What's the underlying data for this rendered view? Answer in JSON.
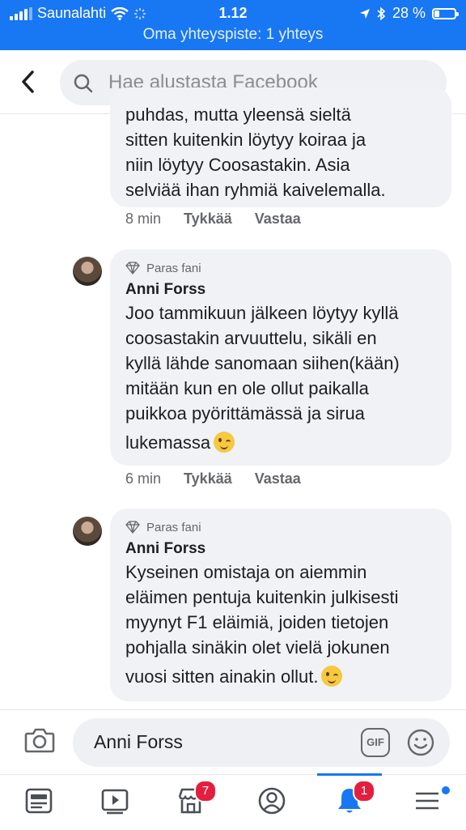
{
  "status": {
    "carrier": "Saunalahti",
    "time": "1.12",
    "battery": "28 %",
    "battery_level": 0.28
  },
  "hotspot": "Oma yhteyspiste: 1 yhteys",
  "search": {
    "placeholder": "Hae alustasta Facebook"
  },
  "comments": [
    {
      "text_lines": [
        "puhdas, mutta yleensä sieltä",
        "sitten kuitenkin löytyy koiraa ja",
        "niin löytyy Coosastakin. Asia",
        "selviää ihan ryhmiä kaivelemalla."
      ],
      "time": "8 min",
      "like": "Tykkää",
      "reply": "Vastaa"
    },
    {
      "badge": "Paras fani",
      "author": "Anni Forss",
      "text_lines": [
        "Joo tammikuun jälkeen löytyy kyllä",
        "coosastakin arvuuttelu, sikäli en",
        "kyllä lähde sanomaan siihen(kään)",
        "mitään kun en ole ollut paikalla",
        "puikkoa pyörittämässä ja sirua",
        "lukemassa"
      ],
      "time": "6 min",
      "like": "Tykkää",
      "reply": "Vastaa"
    },
    {
      "badge": "Paras fani",
      "author": "Anni Forss",
      "text_lines": [
        "Kyseinen omistaja on aiemmin",
        "eläimen pentuja kuitenkin julkisesti",
        "myynyt F1 eläimiä, joiden tietojen",
        "pohjalla sinäkin olet vielä jokunen",
        "vuosi sitten ainakin ollut."
      ]
    }
  ],
  "composer": {
    "value": "Anni Forss",
    "gif_label": "GIF"
  },
  "tabs": {
    "marketplace_count": "7",
    "notifications_count": "1"
  }
}
